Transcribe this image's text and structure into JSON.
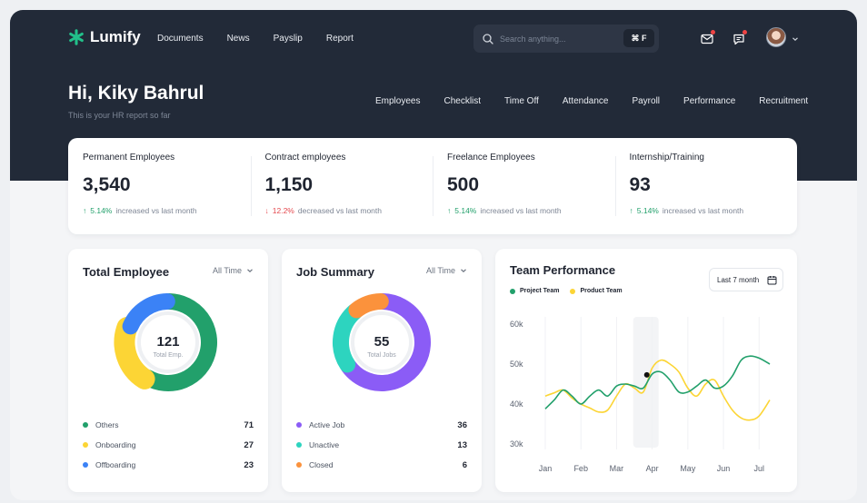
{
  "brand": {
    "name": "Lumify",
    "color": "#22c08a"
  },
  "nav": {
    "items": [
      "Documents",
      "News",
      "Payslip",
      "Report"
    ]
  },
  "search": {
    "placeholder": "Search anything...",
    "shortcut": "⌘ F"
  },
  "header": {
    "greeting": "Hi, Kiky Bahrul",
    "subtitle": "This is your HR report so far"
  },
  "subnav": {
    "items": [
      "Employees",
      "Checklist",
      "Time Off",
      "Attendance",
      "Payroll",
      "Performance",
      "Recruitment"
    ]
  },
  "stats": [
    {
      "title": "Permanent Employees",
      "value": "3,540",
      "direction": "up",
      "change": "5.14%",
      "note": "increased vs last month"
    },
    {
      "title": "Contract employees",
      "value": "1,150",
      "direction": "down",
      "change": "12.2%",
      "note": "decreased vs last month"
    },
    {
      "title": "Freelance Employees",
      "value": "500",
      "direction": "up",
      "change": "5.14%",
      "note": "increased vs last month"
    },
    {
      "title": "Internship/Training",
      "value": "93",
      "direction": "up",
      "change": "5.14%",
      "note": "increased vs last month"
    }
  ],
  "total_employee": {
    "title": "Total Employee",
    "filter": "All Time",
    "center_value": "121",
    "center_label": "Total Emp.",
    "items": [
      {
        "label": "Others",
        "value": 71,
        "color": "#22a06b"
      },
      {
        "label": "Onboarding",
        "value": 27,
        "color": "#fcd535"
      },
      {
        "label": "Offboarding",
        "value": 23,
        "color": "#3b82f6"
      }
    ]
  },
  "job_summary": {
    "title": "Job Summary",
    "filter": "All Time",
    "center_value": "55",
    "center_label": "Total Jobs",
    "items": [
      {
        "label": "Active Job",
        "value": 36,
        "color": "#8b5cf6"
      },
      {
        "label": "Unactive",
        "value": 13,
        "color": "#2dd4bf"
      },
      {
        "label": "Closed",
        "value": 6,
        "color": "#fb923c"
      }
    ]
  },
  "team_performance": {
    "title": "Team Performance",
    "range_label": "Last 7 month",
    "chart_data": {
      "type": "line",
      "categories": [
        "Jan",
        "Feb",
        "Mar",
        "Apr",
        "May",
        "Jun",
        "Jul"
      ],
      "x": [
        0,
        0.25,
        0.5,
        0.75,
        1,
        1.25,
        1.5,
        1.75,
        2,
        2.25,
        2.5,
        2.75,
        3,
        3.25,
        3.5,
        3.75,
        4,
        4.25,
        4.5,
        4.75,
        5,
        5.25,
        5.5,
        5.75,
        6,
        6.3
      ],
      "series": [
        {
          "name": "Project Team",
          "color": "#22a06b",
          "values": [
            38.8,
            41,
            43.5,
            42,
            40,
            42,
            43.5,
            42,
            44.5,
            45,
            44.5,
            44,
            47.5,
            48,
            46,
            43,
            43,
            44.5,
            46,
            44,
            44.5,
            47,
            51,
            52,
            51.5,
            50
          ]
        },
        {
          "name": "Product Team",
          "color": "#fcd535",
          "values": [
            42,
            42.8,
            43.5,
            41.5,
            40,
            39,
            38,
            38.5,
            42,
            45,
            44,
            43,
            49,
            51,
            50,
            48,
            44,
            42,
            45,
            46,
            42,
            38.5,
            36.5,
            36,
            37,
            41
          ]
        }
      ],
      "ylim": [
        30,
        60
      ],
      "yticks": [
        "30k",
        "40k",
        "50k",
        "60k"
      ],
      "highlight": {
        "category": "Apr",
        "x": 2.85,
        "y": 47.3
      }
    }
  }
}
